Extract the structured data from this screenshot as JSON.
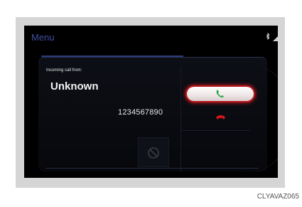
{
  "screen": {
    "title": "Menu"
  },
  "status_bar": {
    "icons": [
      "bluetooth-icon",
      "signal-icon",
      "battery-icon"
    ]
  },
  "call": {
    "heading": "Incoming call from:",
    "caller_name": "Unknown",
    "number": "1234567890"
  },
  "actions": {
    "answer_icon": "phone-answer-icon",
    "decline_icon": "phone-hangup-icon",
    "mute_icon": "disabled-icon"
  },
  "colors": {
    "accent_red": "#d01818",
    "answer_green": "#2aa84a",
    "title_blue": "#3f4fa0"
  },
  "caption": "CLYAVAZ065"
}
